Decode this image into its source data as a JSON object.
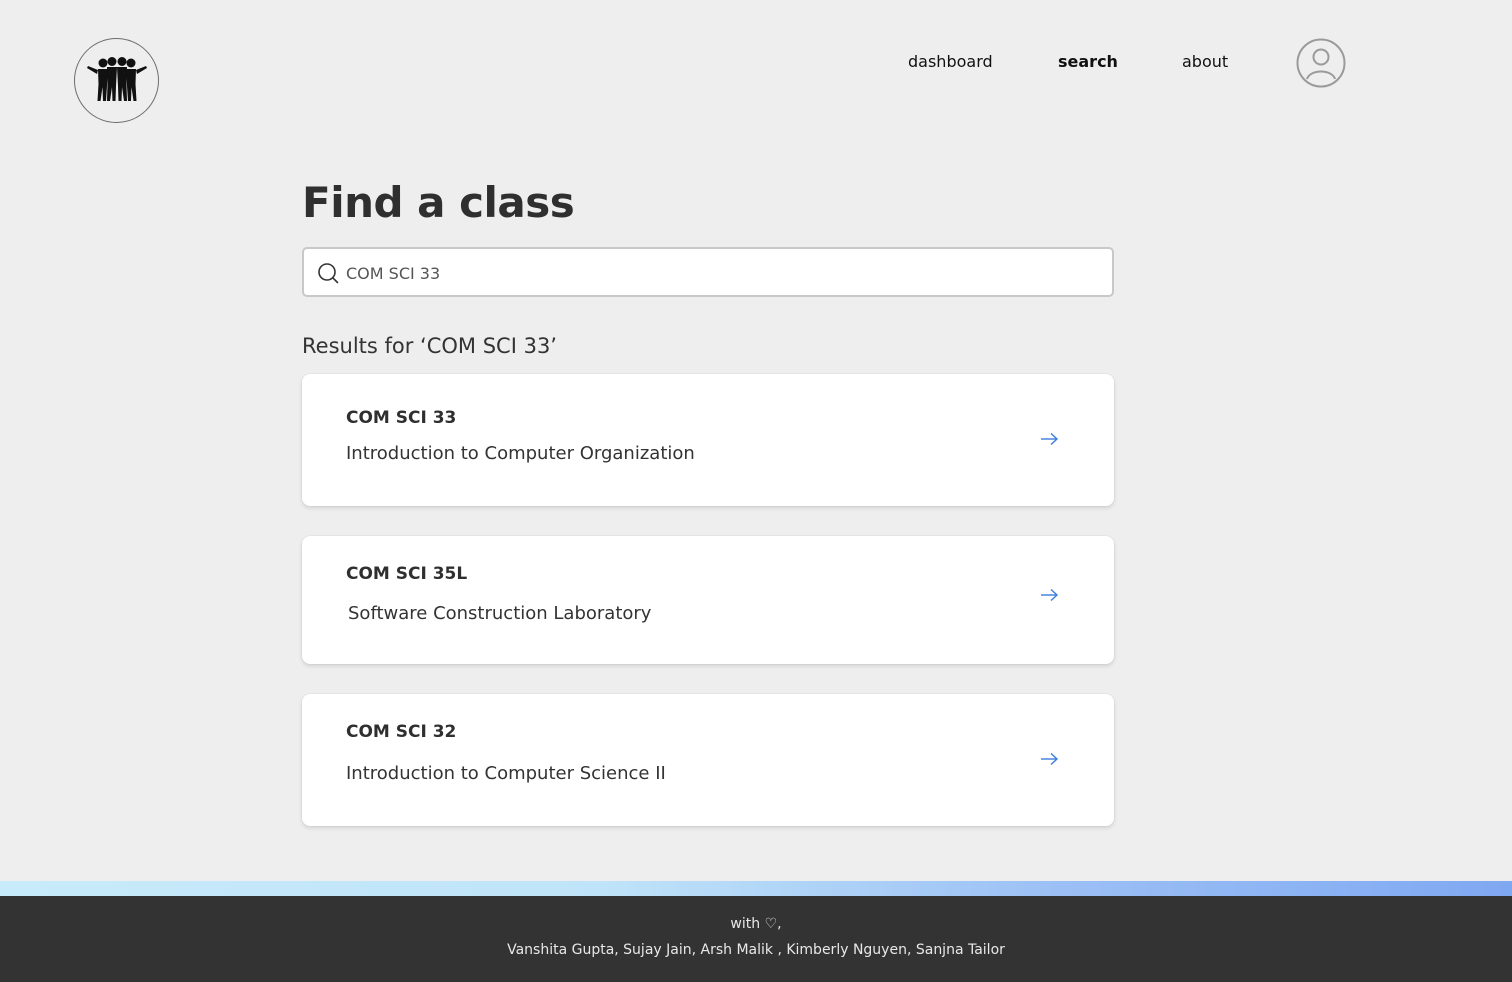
{
  "header": {
    "nav": [
      {
        "label": "dashboard",
        "active": false
      },
      {
        "label": "search",
        "active": true
      },
      {
        "label": "about",
        "active": false
      }
    ]
  },
  "main": {
    "title": "Find a class",
    "search": {
      "value": "COM SCI 33",
      "placeholder": ""
    },
    "results_heading": "Results for ‘COM SCI 33’",
    "results": [
      {
        "code": "COM SCI 33",
        "name": "Introduction to Computer Organization"
      },
      {
        "code": "COM SCI 35L",
        "name": "Software Construction Laboratory"
      },
      {
        "code": "COM SCI 32",
        "name": "Introduction to Computer Science II"
      }
    ]
  },
  "footer": {
    "line1": "with ♡,",
    "line2": "Vanshita Gupta, Sujay Jain, Arsh Malik , Kimberly Nguyen, Sanjna Tailor"
  },
  "colors": {
    "background": "#eeeeee",
    "accent_arrow": "#3b7ddd",
    "footer_bg": "#333333"
  },
  "icons": {
    "logo": "group-people-logo",
    "avatar": "user-avatar-icon",
    "search": "search-icon",
    "result_arrow": "arrow-right-icon"
  }
}
